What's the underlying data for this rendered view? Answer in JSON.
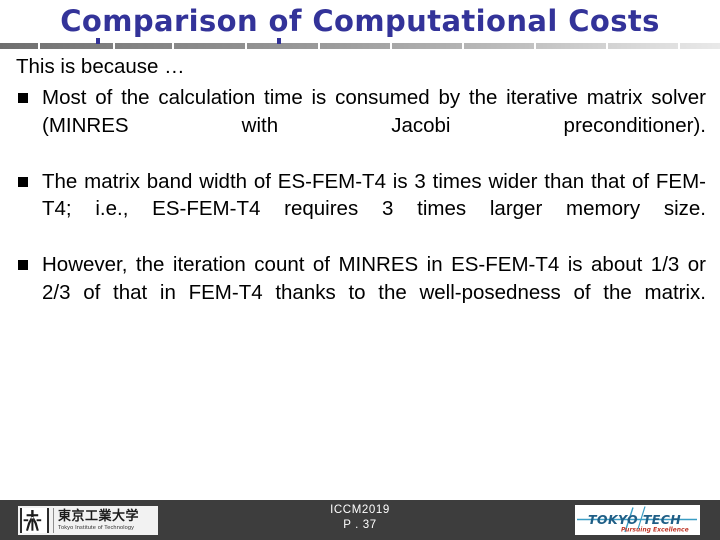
{
  "slide": {
    "title": "Comparison of Computational Costs",
    "lead": "This is because …",
    "bullets": [
      "Most of the calculation time is consumed by the iterative matrix solver (MINRES with Jacobi preconditioner).",
      "The matrix band width of ES-FEM-T4 is 3 times wider than that of FEM-T4; i.e., ES-FEM-T4 requires 3 times larger memory size.",
      "However, the iteration count of MINRES in ES-FEM-T4 is about 1/3 or 2/3 of that in FEM-T4 thanks to the well-posedness of the matrix."
    ]
  },
  "footer": {
    "conference": "ICCM2019",
    "page": "P . 37",
    "logo_left": {
      "japanese_name": "東京工業大学",
      "english_name": "Tokyo Institute of Technology",
      "crest_icon": "tokyo-tech-crest-icon"
    },
    "logo_right": {
      "wordmark": "TOKYO TECH",
      "tagline": "Pursuing Excellence"
    }
  },
  "colors": {
    "title": "#333399",
    "body_text": "#000000",
    "footer_bar": "#3d3d3d",
    "footer_text": "#ffffff",
    "logo_right_wordmark": "#2e7fa8",
    "logo_right_tagline": "#c0392b",
    "background": "#ffffff"
  }
}
